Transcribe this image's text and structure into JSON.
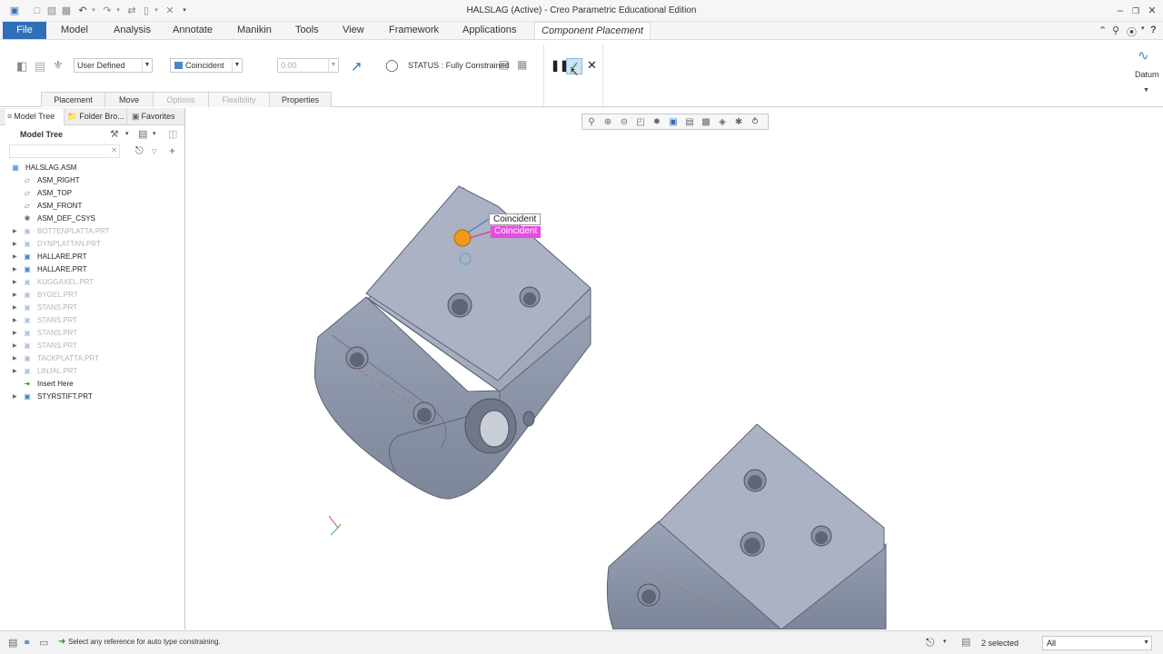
{
  "window": {
    "title": "HALSLAG (Active) - Creo Parametric Educational Edition"
  },
  "menubar": {
    "file": "File",
    "tabs": [
      "Model",
      "Analysis",
      "Annotate",
      "Manikin",
      "Tools",
      "View",
      "Framework",
      "Applications"
    ],
    "active_tab": "Component Placement"
  },
  "ribbon": {
    "constraint_set": "User Defined",
    "constraint_type": "Coincident",
    "offset_value": "0.00",
    "status": "STATUS : Fully Constrained",
    "datum_label": "Datum",
    "subtabs": {
      "placement": "Placement",
      "move": "Move",
      "options": "Options",
      "flexibility": "Flexibility",
      "properties": "Properties"
    }
  },
  "panel": {
    "tabs": {
      "model_tree": "Model Tree",
      "folder_browser": "Folder Bro...",
      "favorites": "Favorites"
    },
    "title": "Model Tree",
    "items": [
      {
        "label": "HALSLAG.ASM",
        "icon": "assembly-icon",
        "dim": false
      },
      {
        "label": "ASM_RIGHT",
        "icon": "datum-plane-icon",
        "dim": false
      },
      {
        "label": "ASM_TOP",
        "icon": "datum-plane-icon",
        "dim": false
      },
      {
        "label": "ASM_FRONT",
        "icon": "datum-plane-icon",
        "dim": false
      },
      {
        "label": "ASM_DEF_CSYS",
        "icon": "csys-icon",
        "dim": false
      },
      {
        "label": "BOTTENPLATTA.PRT",
        "icon": "part-icon",
        "dim": true
      },
      {
        "label": "DYNPLATTAN.PRT",
        "icon": "part-icon",
        "dim": true
      },
      {
        "label": "HALLARE.PRT",
        "icon": "part-icon",
        "dim": false
      },
      {
        "label": "HALLARE.PRT",
        "icon": "part-icon",
        "dim": false
      },
      {
        "label": "KUGGAXEL.PRT",
        "icon": "part-icon",
        "dim": true
      },
      {
        "label": "BYGEL.PRT",
        "icon": "part-icon",
        "dim": true
      },
      {
        "label": "STANS.PRT",
        "icon": "part-icon",
        "dim": true
      },
      {
        "label": "STANS.PRT",
        "icon": "part-icon",
        "dim": true
      },
      {
        "label": "STANS.PRT",
        "icon": "part-icon",
        "dim": true
      },
      {
        "label": "STANS.PRT",
        "icon": "part-icon",
        "dim": true
      },
      {
        "label": "TACKPLATTA.PRT",
        "icon": "part-icon",
        "dim": true
      },
      {
        "label": "LINJAL.PRT",
        "icon": "part-icon",
        "dim": true
      },
      {
        "label": "Insert Here",
        "icon": "insert-here-icon",
        "dim": false
      },
      {
        "label": "STYRSTIFT.PRT",
        "icon": "part-icon",
        "dim": false
      }
    ]
  },
  "viewport": {
    "callout_1": "Coincident",
    "callout_2": "Coincident"
  },
  "statusbar": {
    "message": "Select any reference for auto type constraining.",
    "selected": "2 selected",
    "filter": "All"
  },
  "colors": {
    "accent": "#2e6fb8",
    "part_gray": "#a7b0c1",
    "callout_magenta": "#e74be0",
    "handle_orange": "#f09a1a"
  }
}
